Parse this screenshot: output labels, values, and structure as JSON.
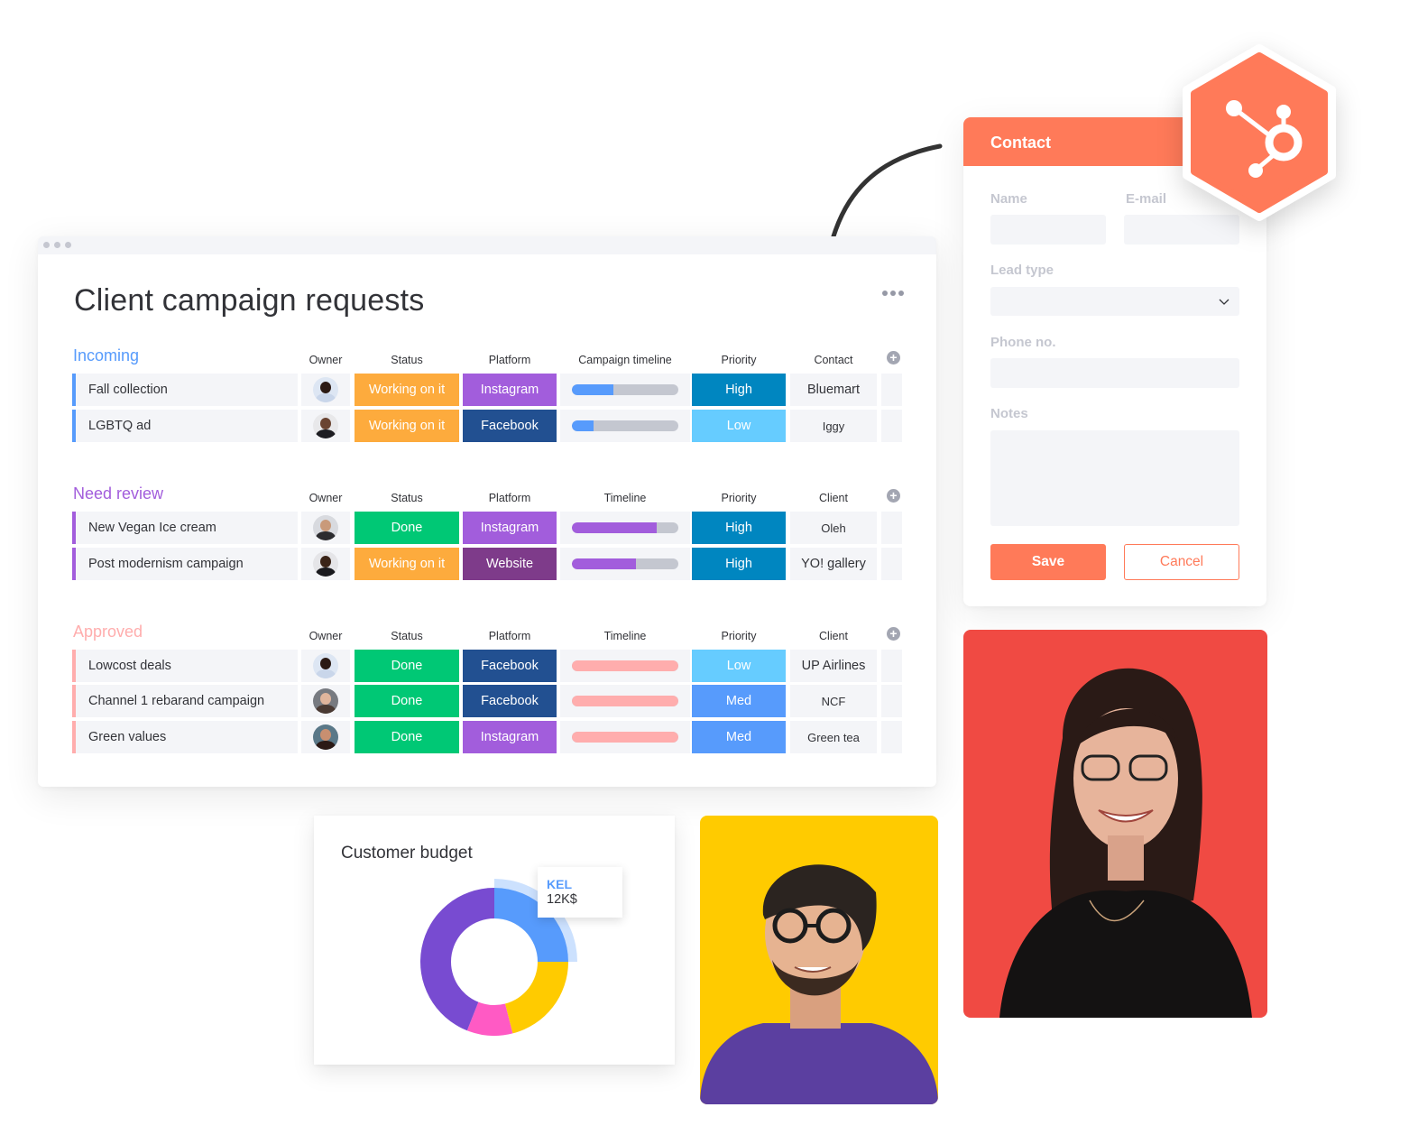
{
  "board": {
    "title": "Client campaign requests",
    "groups": [
      {
        "title": "Incoming",
        "color": "#579bfc",
        "columns": [
          "Owner",
          "Status",
          "Platform",
          "Campaign timeline",
          "Priority",
          "Contact"
        ],
        "rows": [
          {
            "name": "Fall collection",
            "owner": "avatar-woman-dark-curly",
            "status": "Working on it",
            "platform": "Instagram",
            "timeline_progress": 0.39,
            "timeline_color": "#579bfc",
            "priority": "High",
            "client": "Bluemart"
          },
          {
            "name": "LGBTQ ad",
            "owner": "avatar-man-bald-smiling",
            "status": "Working on it",
            "platform": "Facebook",
            "timeline_progress": 0.2,
            "timeline_color": "#579bfc",
            "priority": "Low",
            "client": "Iggy"
          }
        ]
      },
      {
        "title": "Need review",
        "color": "#a25ddc",
        "columns": [
          "Owner",
          "Status",
          "Platform",
          "Timeline",
          "Priority",
          "Client"
        ],
        "rows": [
          {
            "name": "New Vegan Ice cream",
            "owner": "avatar-man-beard",
            "status": "Done",
            "platform": "Instagram",
            "timeline_progress": 0.8,
            "timeline_color": "#a25ddc",
            "priority": "High",
            "client": "Oleh"
          },
          {
            "name": "Post modernism campaign",
            "owner": "avatar-man-bald-beard",
            "status": "Working on it",
            "platform": "Website",
            "timeline_progress": 0.6,
            "timeline_color": "#a25ddc",
            "priority": "High",
            "client": "YO! gallery"
          }
        ]
      },
      {
        "title": "Approved",
        "color": "#ffadad",
        "columns": [
          "Owner",
          "Status",
          "Platform",
          "Timeline",
          "Priority",
          "Client"
        ],
        "rows": [
          {
            "name": "Lowcost deals",
            "owner": "avatar-woman-dark-curly",
            "status": "Done",
            "platform": "Facebook",
            "timeline_progress": 1.0,
            "timeline_color": "#ffadad",
            "priority": "Low",
            "client": "UP Airlines"
          },
          {
            "name": "Channel 1 rebarand campaign",
            "owner": "avatar-woman-smiling",
            "status": "Done",
            "platform": "Facebook",
            "timeline_progress": 1.0,
            "timeline_color": "#ffadad",
            "priority": "Med",
            "client": "NCF"
          },
          {
            "name": "Green values",
            "owner": "avatar-woman-long-hair",
            "status": "Done",
            "platform": "Instagram",
            "timeline_progress": 1.0,
            "timeline_color": "#ffadad",
            "priority": "Med",
            "client": "Green tea"
          }
        ]
      }
    ],
    "status_colors": {
      "Working on it": "#fdab3d",
      "Done": "#00c875"
    },
    "platform_colors": {
      "Instagram": "#a25ddc",
      "Facebook": "#225091",
      "Website": "#7e3b8a"
    },
    "priority_colors": {
      "High": "#0086c0",
      "Low": "#66ccff",
      "Med": "#579bfc"
    }
  },
  "contact_form": {
    "title": "Contact",
    "fields": {
      "name_label": "Name",
      "email_label": "E-mail",
      "lead_type_label": "Lead type",
      "phone_label": "Phone no.",
      "notes_label": "Notes"
    },
    "save_label": "Save",
    "cancel_label": "Cancel",
    "brand_color": "#ff7a59",
    "badge_icon": "hubspot-sprocket-icon"
  },
  "budget_widget": {
    "title": "Customer budget",
    "tooltip": {
      "name": "KEL",
      "value": "12K$"
    }
  },
  "chart_data": {
    "type": "pie",
    "title": "Customer budget",
    "donut": true,
    "slices": [
      {
        "label": "KEL",
        "value": 25,
        "color": "#579bfc",
        "highlighted": true
      },
      {
        "label": "",
        "value": 21,
        "color": "#ffcb00"
      },
      {
        "label": "",
        "value": 10,
        "color": "#ff5ac4"
      },
      {
        "label": "",
        "value": 44,
        "color": "#784bd1"
      }
    ],
    "units": "percent of total (estimated)",
    "tooltip": {
      "label": "KEL",
      "value": "12K$"
    }
  }
}
